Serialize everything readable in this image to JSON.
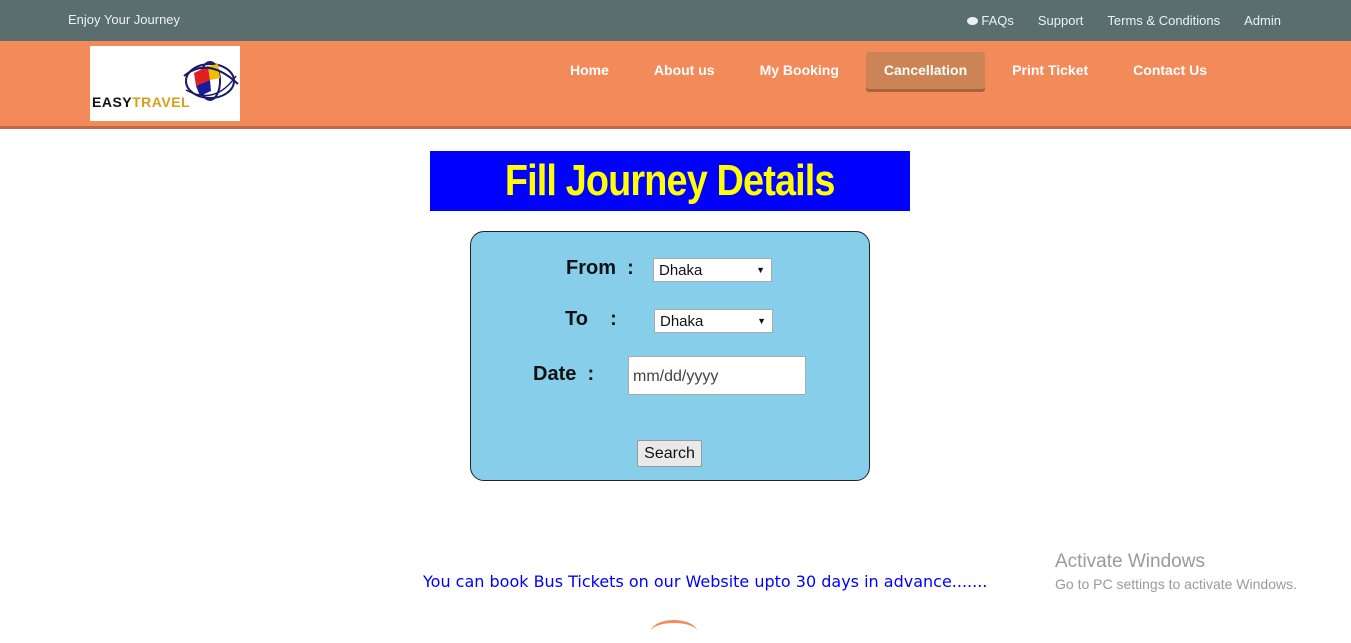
{
  "topbar": {
    "tagline": "Enjoy Your Journey",
    "links": {
      "faqs": "FAQs",
      "support": "Support",
      "terms": "Terms & Conditions",
      "admin": "Admin"
    }
  },
  "logo": {
    "brand_part1": "EASY",
    "brand_part2": "TRAVEL"
  },
  "nav": {
    "home": "Home",
    "about": "About us",
    "booking": "My Booking",
    "cancellation": "Cancellation",
    "print": "Print Ticket",
    "contact": "Contact Us",
    "active": "Cancellation"
  },
  "title": "Fill Journey Details",
  "form": {
    "from_label": "From  :",
    "from_value": "Dhaka",
    "to_label": "To    :",
    "to_value": "Dhaka",
    "date_label": "Date  :",
    "date_placeholder": "mm/dd/yyyy",
    "search_label": "Search"
  },
  "notice": "You can book Bus Tickets on our Website upto 30 days in advance.......",
  "watermark": {
    "line1": "Activate Windows",
    "line2": "Go to PC settings to activate Windows."
  },
  "colors": {
    "topbar": "#5a6e6e",
    "navbar": "#f28a5a",
    "active_tab": "#cc8356",
    "title_bg": "#0000ff",
    "title_text": "#ffff00",
    "form_bg": "#87ceeb",
    "notice_text": "#0000ff"
  }
}
